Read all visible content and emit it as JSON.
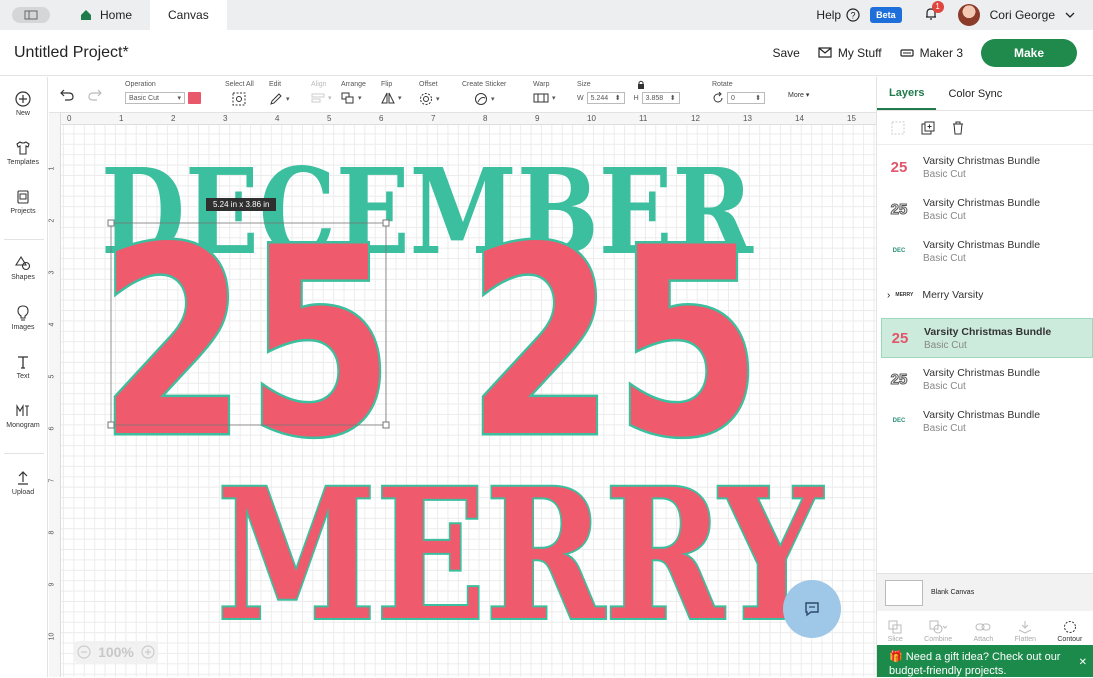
{
  "topbar": {
    "tabs": [
      {
        "label": "Home"
      },
      {
        "label": "Canvas"
      }
    ],
    "help_label": "Help",
    "beta_label": "Beta",
    "notification_count": "1",
    "user_name": "Cori George"
  },
  "header": {
    "project_title": "Untitled Project*",
    "save_label": "Save",
    "mystuff_label": "My Stuff",
    "machine_label": "Maker 3",
    "make_label": "Make"
  },
  "leftbar": {
    "items": [
      {
        "label": "New",
        "icon": "plus-circle-icon"
      },
      {
        "label": "Templates",
        "icon": "shirt-icon"
      },
      {
        "label": "Projects",
        "icon": "projects-icon"
      },
      {
        "label": "Shapes",
        "icon": "shapes-icon"
      },
      {
        "label": "Images",
        "icon": "lightbulb-icon"
      },
      {
        "label": "Text",
        "icon": "text-icon"
      },
      {
        "label": "Monogram",
        "icon": "monogram-icon"
      },
      {
        "label": "Upload",
        "icon": "upload-icon"
      }
    ]
  },
  "toolbar": {
    "operation_label": "Operation",
    "operation_value": "Basic Cut",
    "select_all_label": "Select All",
    "edit_label": "Edit",
    "align_label": "Align",
    "arrange_label": "Arrange",
    "flip_label": "Flip",
    "offset_label": "Offset",
    "create_sticker_label": "Create Sticker",
    "warp_label": "Warp",
    "size_label": "Size",
    "w_label": "W",
    "w_value": "5.244",
    "h_label": "H",
    "h_value": "3.858",
    "rotate_label": "Rotate",
    "rotate_value": "0",
    "more_label": "More",
    "swatch_color": "#e8576a"
  },
  "canvas": {
    "ruler_top": [
      "0",
      "1",
      "2",
      "3",
      "4",
      "5",
      "6",
      "7",
      "8",
      "9",
      "10",
      "11",
      "12",
      "13",
      "14",
      "15"
    ],
    "ruler_left": [
      "1",
      "2",
      "3",
      "4",
      "5",
      "6",
      "7",
      "8",
      "9",
      "10"
    ],
    "size_tooltip": "5.24  in x 3.86  in",
    "zoom_value": "100%",
    "design": {
      "word_top": "DECEMBER",
      "number_left": "25",
      "number_right": "25",
      "word_bottom": "MERRY",
      "teal": "#3bbf9e",
      "coral": "#ef5b6d"
    }
  },
  "rightpanel": {
    "tabs": [
      {
        "label": "Layers"
      },
      {
        "label": "Color Sync"
      }
    ],
    "layers": [
      {
        "thumb": "25",
        "name": "Varsity Christmas Bundle",
        "sub": "Basic Cut"
      },
      {
        "thumb": "25",
        "name": "Varsity Christmas Bundle",
        "sub": "Basic Cut"
      },
      {
        "thumb": "DEC",
        "name": "Varsity Christmas Bundle",
        "sub": "Basic Cut"
      },
      {
        "thumb": "MERRY",
        "name": "Merry Varsity",
        "sub": ""
      },
      {
        "thumb": "25",
        "name": "Varsity Christmas Bundle",
        "sub": "Basic Cut"
      },
      {
        "thumb": "25",
        "name": "Varsity Christmas Bundle",
        "sub": "Basic Cut"
      },
      {
        "thumb": "DEC",
        "name": "Varsity Christmas Bundle",
        "sub": "Basic Cut"
      }
    ],
    "blank_canvas_label": "Blank Canvas",
    "bottom_tools": [
      {
        "label": "Slice"
      },
      {
        "label": "Combine"
      },
      {
        "label": "Attach"
      },
      {
        "label": "Flatten"
      },
      {
        "label": "Contour"
      }
    ],
    "gift_text": "Need a gift idea? Check out our budget-friendly projects."
  }
}
